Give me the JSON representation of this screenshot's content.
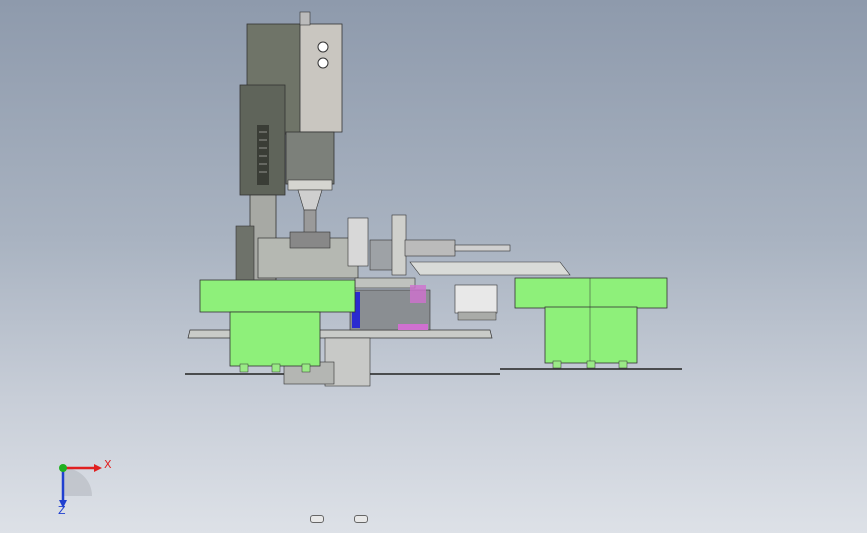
{
  "triad": {
    "x_label": "X",
    "z_label": "Z",
    "x_color": "#e02020",
    "y_color": "#20b020",
    "z_color": "#2040d0"
  },
  "colors": {
    "bowl_green": "#8ef07a",
    "housing_gray": "#6f7468",
    "plate_gray": "#c9cbc8",
    "accent_blue": "#2a2ad0",
    "accent_pink": "#d070d0"
  },
  "controls": [
    {
      "name": "view-control-left"
    },
    {
      "name": "view-control-right"
    }
  ]
}
